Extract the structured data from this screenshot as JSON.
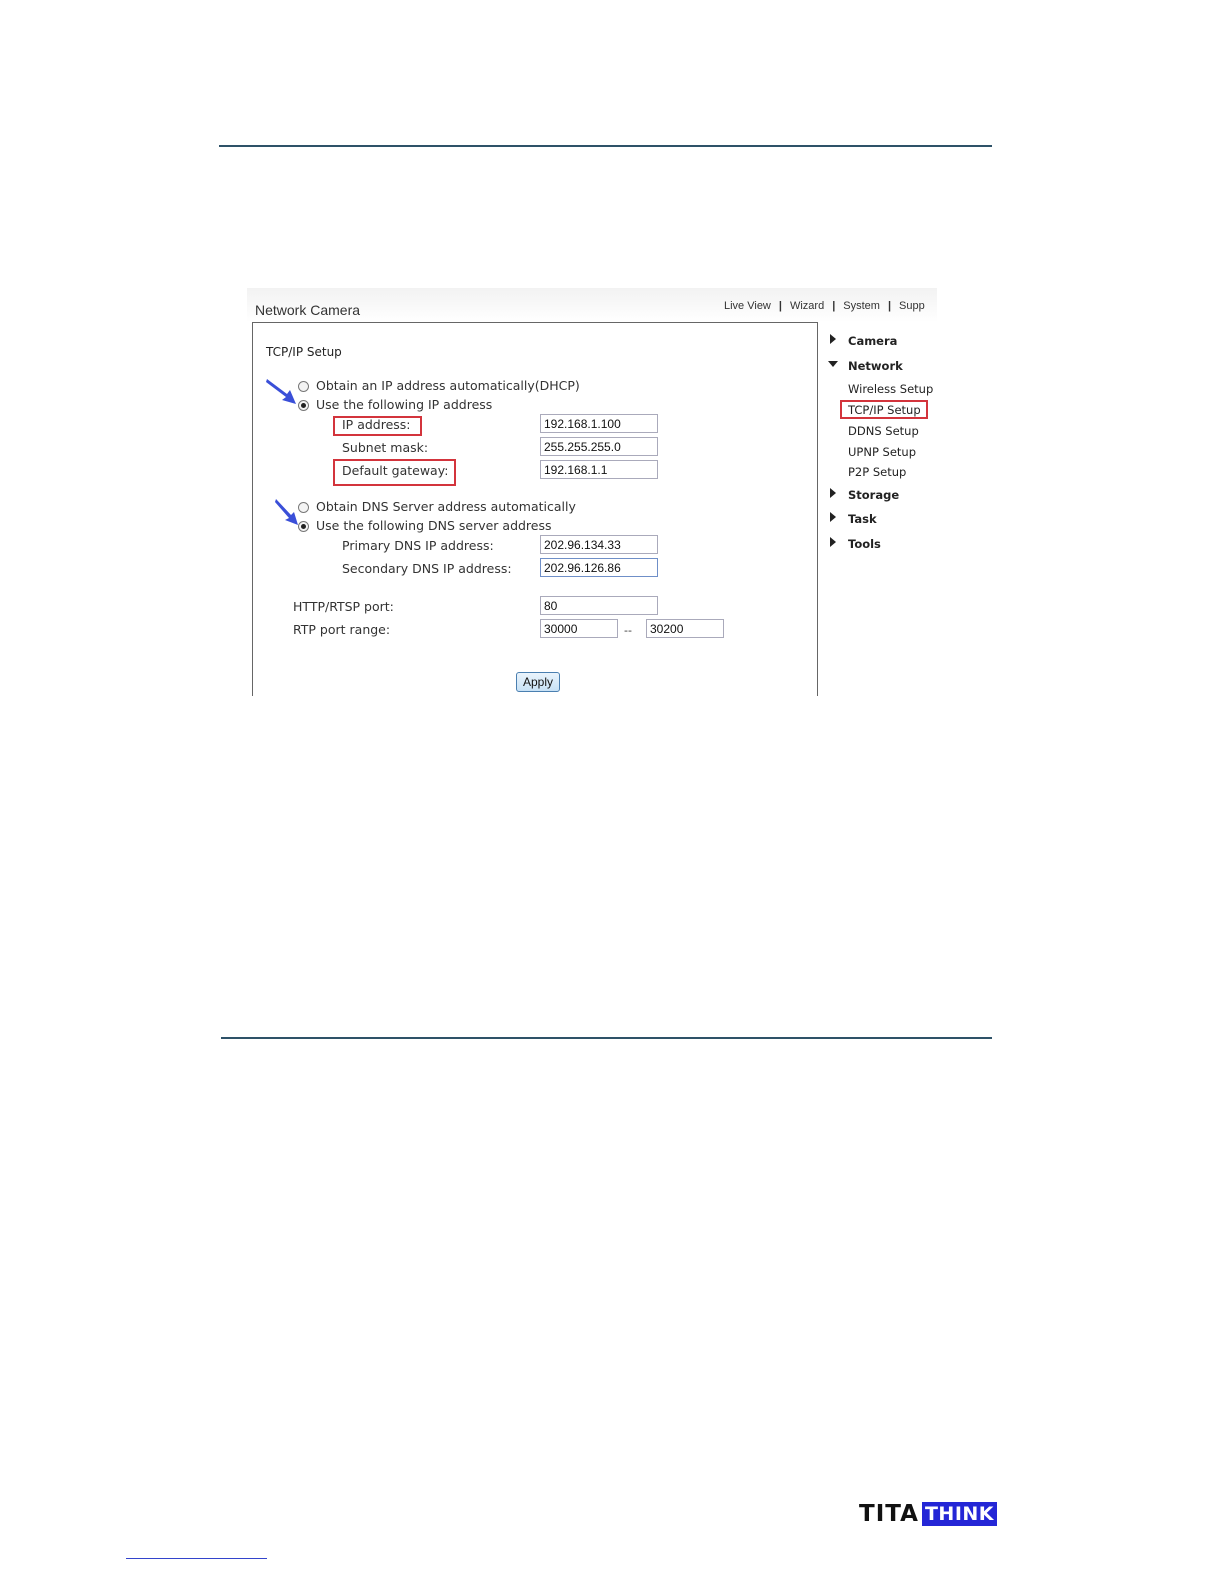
{
  "app": {
    "title": "Network Camera",
    "nav": [
      "Live View",
      "Wizard",
      "System",
      "Supp"
    ]
  },
  "tcpip": {
    "section_title": "TCP/IP Setup",
    "ip_mode": {
      "options": [
        "Obtain an IP address automatically(DHCP)",
        "Use the following IP address"
      ],
      "selected": 1
    },
    "fields": {
      "ip_label": "IP address:",
      "ip_value": "192.168.1.100",
      "mask_label": "Subnet mask:",
      "mask_value": "255.255.255.0",
      "gateway_label": "Default gateway:",
      "gateway_value": "192.168.1.1"
    },
    "dns_mode": {
      "options": [
        "Obtain DNS Server address automatically",
        "Use the following DNS server address"
      ],
      "selected": 1
    },
    "dns": {
      "primary_label": "Primary DNS IP address:",
      "primary_value": "202.96.134.33",
      "secondary_label": "Secondary DNS IP address:",
      "secondary_value": "202.96.126.86"
    },
    "ports": {
      "http_label": "HTTP/RTSP port:",
      "http_value": "80",
      "rtp_label": "RTP port range:",
      "rtp_from": "30000",
      "rtp_sep": "--",
      "rtp_to": "30200"
    },
    "apply_label": "Apply"
  },
  "sidebar": {
    "camera": "Camera",
    "network": "Network",
    "network_items": [
      "Wireless Setup",
      "TCP/IP Setup",
      "DDNS Setup",
      "UPNP Setup",
      "P2P Setup"
    ],
    "storage": "Storage",
    "task": "Task",
    "tools": "Tools"
  },
  "logo": {
    "left": "TITA",
    "right": "THINK"
  },
  "colors": {
    "highlight_box": "#d3343c",
    "arrow": "#3a4fd8",
    "rule": "#2e5268",
    "logo_blue": "#2426d6"
  }
}
